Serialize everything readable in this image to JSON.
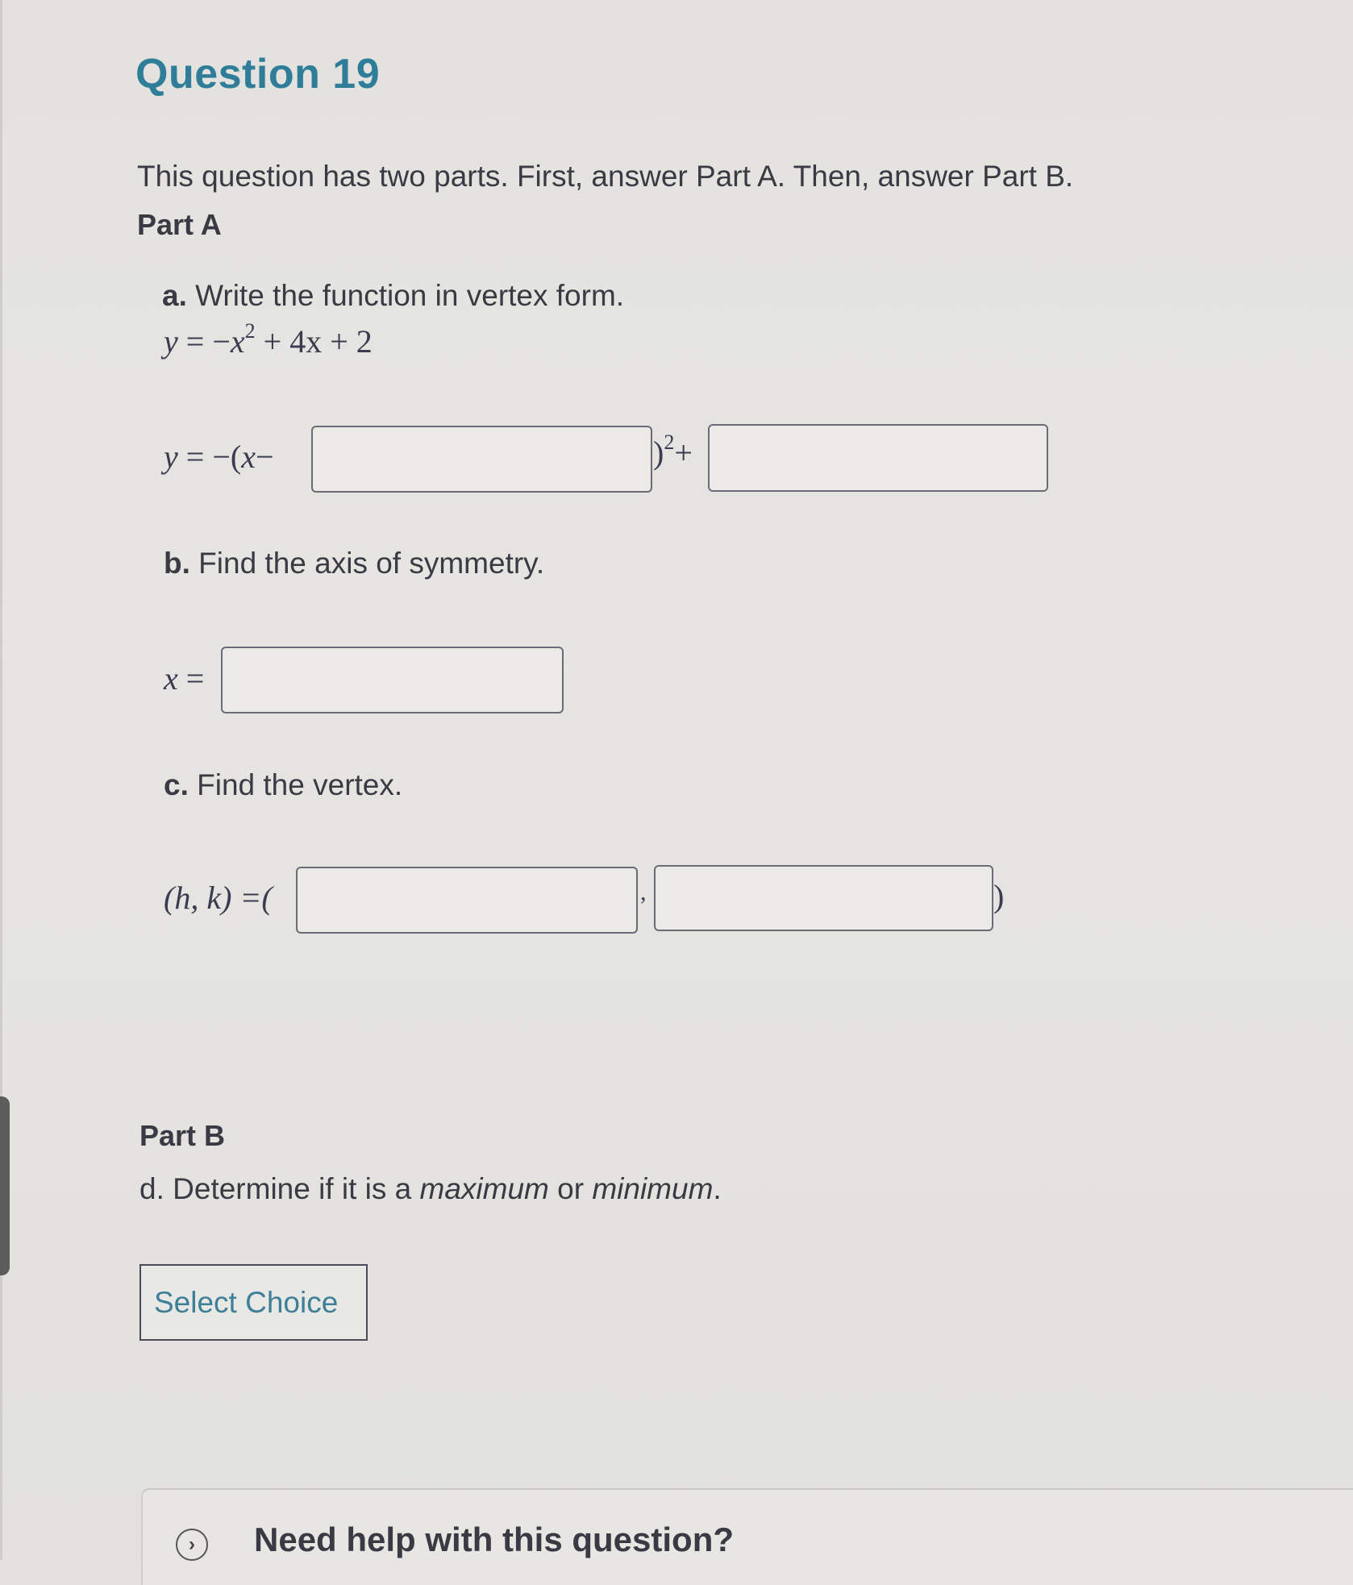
{
  "question": {
    "title": "Question 19",
    "intro": "This question has two parts. First, answer Part A. Then, answer Part B."
  },
  "part_a": {
    "heading": "Part A",
    "item_a": {
      "label": "a.",
      "text": "Write the function in vertex form.",
      "given_equation": {
        "lhs": "y",
        "eq": "=",
        "minus": "−",
        "var": "x",
        "exp": "2",
        "rest": "+ 4x + 2"
      },
      "answer_row": {
        "prefix_y": "y",
        "prefix_eq": "= −(",
        "prefix_x": "x",
        "prefix_minus": "−",
        "close_paren": ")",
        "exponent": "2",
        "plus": "+",
        "h_value": "",
        "k_value": ""
      }
    },
    "item_b": {
      "label": "b.",
      "text": "Find the axis of symmetry.",
      "answer_row": {
        "var": "x",
        "eq": "=",
        "value": ""
      }
    },
    "item_c": {
      "label": "c.",
      "text": "Find the vertex.",
      "answer_row": {
        "lhs": "(h, k) =(",
        "comma": ",",
        "close": ")",
        "h_value": "",
        "k_value": ""
      }
    }
  },
  "part_b": {
    "heading": "Part B",
    "item_d": {
      "label": "d.",
      "text_before": "Determine if it is a ",
      "maximum": "maximum",
      "or": " or ",
      "minimum": "minimum",
      "period": "."
    },
    "select": {
      "label": "Select Choice"
    }
  },
  "help": {
    "text": "Need help with this question?",
    "icon": "chevron-right-circle-icon"
  }
}
